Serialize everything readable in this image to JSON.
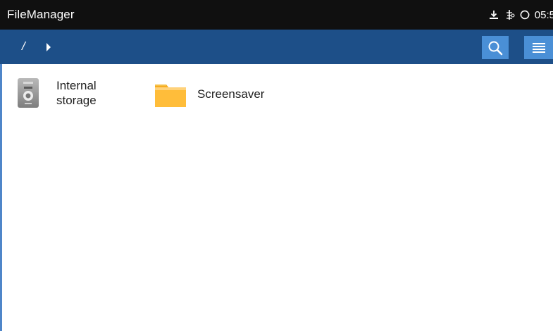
{
  "app": {
    "title": "FileManager",
    "accent_color": "#1d4f88",
    "button_color": "#4a8fd6"
  },
  "status_bar": {
    "time": "05:5",
    "icons": [
      "download-icon",
      "network-icon",
      "sync-icon"
    ]
  },
  "toolbar": {
    "breadcrumb_root": "/",
    "breadcrumb_arrow_icon": "chevron-right-icon",
    "search_icon": "search-icon",
    "menu_icon": "menu-icon"
  },
  "files": [
    {
      "label": "Internal\nstorage",
      "icon": "storage-icon"
    },
    {
      "label": "Screensaver",
      "icon": "folder-icon"
    }
  ]
}
